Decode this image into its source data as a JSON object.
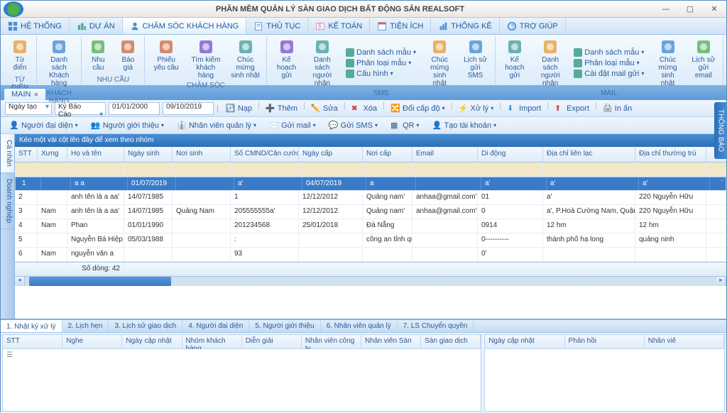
{
  "app": {
    "title": "PHẦN MỀM QUẢN LÝ SÀN GIAO DỊCH BẤT ĐỘNG SẢN REALSOFT"
  },
  "win": {
    "min": "—",
    "max": "▢",
    "close": "✕"
  },
  "menus": [
    {
      "label": "HỆ THỐNG"
    },
    {
      "label": "DỰ ÁN"
    },
    {
      "label": "CHĂM SÓC KHÁCH HÀNG",
      "active": true
    },
    {
      "label": "THỦ TỤC"
    },
    {
      "label": "KẾ TOÁN"
    },
    {
      "label": "TIỆN ÍCH"
    },
    {
      "label": "THỐNG KÊ"
    },
    {
      "label": "TRỢ GIÚP"
    }
  ],
  "ribbon": {
    "groups": [
      {
        "name": "TỪ ĐIỂN",
        "items": [
          {
            "label": "Từ điển"
          }
        ]
      },
      {
        "name": "KHÁCH HÀNG",
        "items": [
          {
            "label": "Danh sách Khách hàng"
          }
        ]
      },
      {
        "name": "NHU CẦU",
        "items": [
          {
            "label": "Nhu cầu"
          },
          {
            "label": "Báo giá"
          }
        ]
      },
      {
        "name": "CHĂM SÓC",
        "items": [
          {
            "label": "Phiếu yêu cầu"
          },
          {
            "label": "Tìm kiếm khách hàng"
          },
          {
            "label": "Chúc mừng sinh nhật"
          }
        ]
      },
      {
        "name": "SMS",
        "big": [
          {
            "label": "Kế hoạch gửi"
          },
          {
            "label": "Danh sách người nhận"
          }
        ],
        "small": [
          {
            "label": "Danh sách mẫu"
          },
          {
            "label": "Phân loại mẫu"
          },
          {
            "label": "Cấu hình"
          }
        ],
        "right": [
          {
            "label": "Chúc mừng sinh nhật"
          },
          {
            "label": "Lịch sử gửi SMS"
          }
        ]
      },
      {
        "name": "MAIL",
        "big": [
          {
            "label": "Kế hoạch gửi"
          },
          {
            "label": "Danh sách người nhận"
          }
        ],
        "small": [
          {
            "label": "Danh sách mẫu"
          },
          {
            "label": "Phân loại mẫu"
          },
          {
            "label": "Cài đặt mail gửi"
          }
        ],
        "right": [
          {
            "label": "Chúc mừng sinh nhật"
          },
          {
            "label": "Lịch sử gửi email"
          }
        ]
      }
    ]
  },
  "tabs": {
    "main": "MAIN",
    "close": "✕"
  },
  "toolbar1": {
    "sel1": "Ngày tạo",
    "sel2": "Kỳ Báo Cáo",
    "date1": "01/01/2000",
    "date2": "09/10/2019",
    "btns": [
      {
        "label": "Nạp"
      },
      {
        "label": "Thêm"
      },
      {
        "label": "Sửa"
      },
      {
        "label": "Xóa"
      },
      {
        "label": "Đổi cấp độ"
      },
      {
        "label": "Xử lý"
      },
      {
        "label": "Import"
      },
      {
        "label": "Export"
      },
      {
        "label": "In ấn"
      }
    ]
  },
  "toolbar2": [
    {
      "label": "Người đại diện"
    },
    {
      "label": "Người giới thiệu"
    },
    {
      "label": "Nhân viên quản lý"
    },
    {
      "label": "Gửi mail"
    },
    {
      "label": "Gửi SMS"
    },
    {
      "label": "QR"
    },
    {
      "label": "Tạo tài khoản"
    }
  ],
  "sidetabs": [
    {
      "label": "Cá nhân",
      "active": true
    },
    {
      "label": "Doanh nghiệp"
    }
  ],
  "grid": {
    "groupHint": "Kéo một vài cột lên đây để xem theo nhóm",
    "cols": [
      "STT",
      "Xưng",
      "Họ và tên",
      "Ngày sinh",
      "Nơi sinh",
      "Số CMND/Căn cước",
      "Ngày cấp",
      "Nơi cấp",
      "Email",
      "Di động",
      "Địa chỉ liên lạc",
      "Địa chỉ thường trú"
    ],
    "rows": [
      {
        "stt": "1",
        "xung": "",
        "ho": "a a",
        "ns": "01/07/2019",
        "noi": "",
        "cmnd": "a'",
        "nc": "04/07/2019",
        "noic": "a",
        "em": "",
        "dd": "a'",
        "dc": "a'",
        "tt": "a'",
        "sel": true
      },
      {
        "stt": "2",
        "xung": "",
        "ho": "anh tên là a aa'",
        "ns": "14/07/1985",
        "noi": "",
        "cmnd": "1",
        "nc": "12/12/2012",
        "noic": "Quảng nam'",
        "em": "anhaa@gmail.com'",
        "dd": "01",
        "dc": "a'",
        "tt": "220 Nguyễn Hữu"
      },
      {
        "stt": "3",
        "xung": "Nam",
        "ho": "anh tên là a aa'",
        "ns": "14/07/1985",
        "noi": "Quảng Nam",
        "cmnd": "205555555a'",
        "nc": "12/12/2012",
        "noic": "Quảng nam'",
        "em": "anhaa@gmail.com'",
        "dd": "0",
        "dc": "a', P.Hoà Cường Nam, Quận",
        "tt": "220 Nguyễn Hữu"
      },
      {
        "stt": "4",
        "xung": "Nam",
        "ho": "Phan",
        "ns": "01/01/1990",
        "noi": "",
        "cmnd": "201234568",
        "nc": "25/01/2018",
        "noic": "Đà Nẵng",
        "em": "",
        "dd": "0914",
        "dc": "12 hm",
        "tt": "12 hm"
      },
      {
        "stt": "5",
        "xung": "",
        "ho": "Nguyễn Bá Hiệp ...",
        "ns": "05/03/1988",
        "noi": "",
        "cmnd": ":",
        "nc": "",
        "noic": "công an tỉnh quả...",
        "em": "",
        "dd": "0----------",
        "dc": "thành phố hạ long",
        "tt": "quảng ninh"
      },
      {
        "stt": "6",
        "xung": "Nam",
        "ho": "nguyễn văn a",
        "ns": "",
        "noi": "",
        "cmnd": "93",
        "nc": "",
        "noic": "",
        "em": "",
        "dd": "0'",
        "dc": "",
        "tt": ""
      }
    ],
    "footer": "Số dòng: 42"
  },
  "bottom": {
    "tabs": [
      {
        "label": "1. Nhật ký xử lý",
        "active": true
      },
      {
        "label": "2. Lịch hẹn"
      },
      {
        "label": "3. Lịch sử giao dịch"
      },
      {
        "label": "4. Người đại diện"
      },
      {
        "label": "5. Người giới thiệu"
      },
      {
        "label": "6. Nhân viên quản lý"
      },
      {
        "label": "7. LS Chuyển quyền"
      }
    ],
    "pane1": [
      "STT",
      "Nghe",
      "Ngày cập nhật",
      "Nhóm khách hàng",
      "Diễn giải",
      "Nhân viên công ty",
      "Nhân viên Sàn",
      "Sàn giao dịch"
    ],
    "pane2": [
      "Ngày cập nhật",
      "Phản hồi",
      "Nhân viê"
    ]
  },
  "notify": "THÔNG BÁO"
}
